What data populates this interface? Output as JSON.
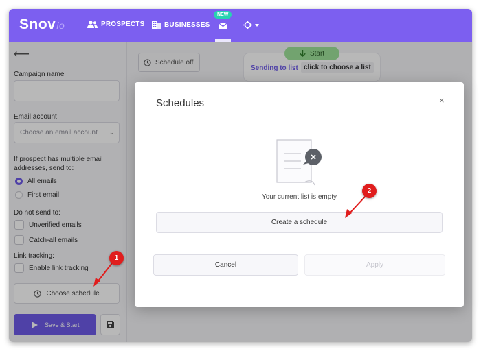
{
  "app": {
    "logo": "Snov",
    "logo_suffix": "io"
  },
  "nav": {
    "prospects": "PROSPECTS",
    "businesses": "BUSINESSES",
    "new_badge": "NEW"
  },
  "sidebar": {
    "campaign_name_label": "Campaign name",
    "campaign_name_value": "",
    "email_account_label": "Email account",
    "email_account_placeholder": "Choose an email account",
    "multiple_email_label": "If prospect has multiple email addresses, send to:",
    "options": [
      "All emails",
      "First email"
    ],
    "selected_option": "All emails",
    "do_not_send_label": "Do not send to:",
    "do_not_send_options": [
      "Unverified emails",
      "Catch-all emails"
    ],
    "link_tracking_label": "Link tracking:",
    "link_tracking_option": "Enable link tracking",
    "choose_schedule": "Choose schedule",
    "save_start": "Save & Start"
  },
  "main": {
    "schedule_off": "Schedule off",
    "start": "Start",
    "sending_to_list": "Sending to list",
    "choose_list": "click to choose a list"
  },
  "modal": {
    "title": "Schedules",
    "close": "×",
    "empty_text": "Your current list is empty",
    "create_button": "Create a schedule",
    "cancel_button": "Cancel",
    "apply_button": "Apply"
  },
  "callouts": [
    "1",
    "2"
  ],
  "colors": {
    "brand": "#7c5ff0",
    "accent": "#6e5be8",
    "callout": "#e01d1d",
    "start_pill": "#9fe29a",
    "new_badge": "#27d3b1"
  }
}
